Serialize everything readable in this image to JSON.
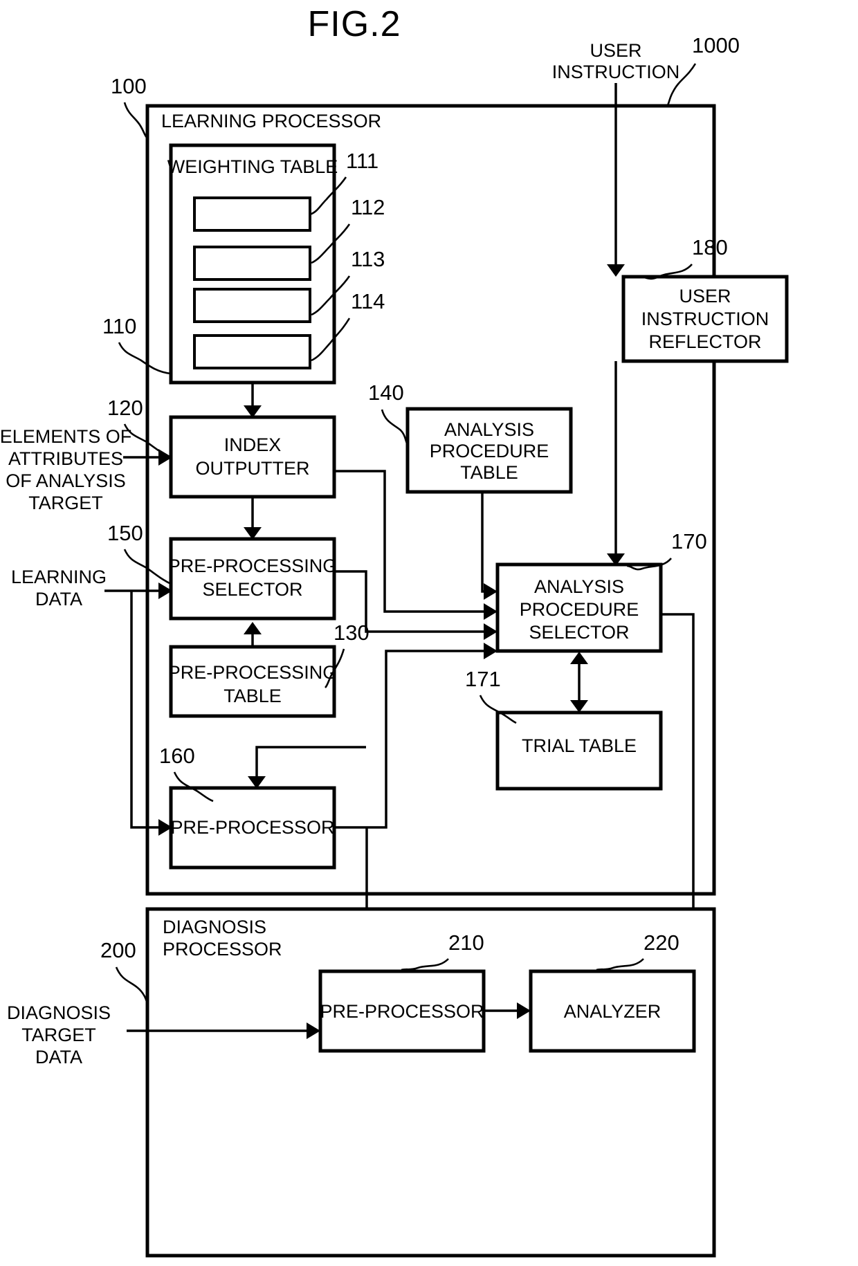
{
  "figure": {
    "title": "FIG.2"
  },
  "external_inputs": {
    "user_instruction": "USER\nINSTRUCTION",
    "user_instruction_line1": "USER",
    "user_instruction_line2": "INSTRUCTION",
    "elements_attributes": {
      "line1": "ELEMENTS OF",
      "line2": "ATTRIBUTES",
      "line3": "OF ANALYSIS",
      "line4": "TARGET"
    },
    "learning_data": {
      "line1": "LEARNING",
      "line2": "DATA"
    },
    "diagnosis_target_data": {
      "line1": "DIAGNOSIS",
      "line2": "TARGET",
      "line3": "DATA"
    }
  },
  "containers": [
    {
      "id": "learning-processor",
      "label": "LEARNING PROCESSOR",
      "ref": "100"
    },
    {
      "id": "diagnosis-processor",
      "label_line1": "DIAGNOSIS",
      "label_line2": "PROCESSOR",
      "ref": "200"
    }
  ],
  "system_ref": "1000",
  "blocks": {
    "weighting_table": {
      "label": "WEIGHTING TABLE",
      "ref": "110",
      "rows": [
        {
          "ref": "111"
        },
        {
          "ref": "112"
        },
        {
          "ref": "113"
        },
        {
          "ref": "114"
        }
      ]
    },
    "index_outputter": {
      "line1": "INDEX",
      "line2": "OUTPUTTER",
      "ref": "120"
    },
    "pre_processing_selector": {
      "line1": "PRE-PROCESSING",
      "line2": "SELECTOR",
      "ref": "150"
    },
    "pre_processing_table": {
      "line1": "PRE-PROCESSING",
      "line2": "TABLE",
      "ref": "130"
    },
    "pre_processor_learning": {
      "label": "PRE-PROCESSOR",
      "ref": "160"
    },
    "analysis_procedure_table": {
      "line1": "ANALYSIS",
      "line2": "PROCEDURE",
      "line3": "TABLE",
      "ref": "140"
    },
    "analysis_procedure_selector": {
      "line1": "ANALYSIS",
      "line2": "PROCEDURE",
      "line3": "SELECTOR",
      "ref": "170"
    },
    "trial_table": {
      "label": "TRIAL TABLE",
      "ref": "171"
    },
    "user_instruction_reflector": {
      "line1": "USER",
      "line2": "INSTRUCTION",
      "line3": "REFLECTOR",
      "ref": "180"
    },
    "pre_processor_diagnosis": {
      "label": "PRE-PROCESSOR",
      "ref": "210"
    },
    "analyzer": {
      "label": "ANALYZER",
      "ref": "220"
    }
  },
  "colors": {
    "stroke": "#000000",
    "fill": "#ffffff"
  }
}
